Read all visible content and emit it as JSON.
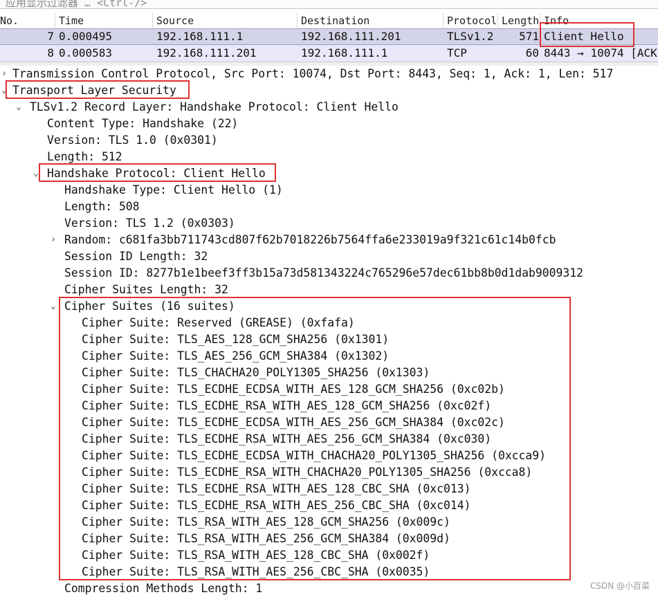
{
  "filter": {
    "placeholder": "应用显示过滤器 … <Ctrl-/>"
  },
  "columns": [
    "No.",
    "Time",
    "Source",
    "Destination",
    "Protocol",
    "Length",
    "Info"
  ],
  "packets": [
    {
      "no": "7",
      "time": "0.000495",
      "source": "192.168.111.1",
      "destination": "192.168.111.201",
      "protocol": "TLSv1.2",
      "length": "571",
      "info": "Client Hello"
    },
    {
      "no": "8",
      "time": "0.000583",
      "source": "192.168.111.201",
      "destination": "192.168.111.1",
      "protocol": "TCP",
      "length": "60",
      "info": "8443 → 10074 [ACK"
    }
  ],
  "tree": {
    "tcp": "Transmission Control Protocol, Src Port: 10074, Dst Port: 8443, Seq: 1, Ack: 1, Len: 517",
    "tls": "Transport Layer Security",
    "record": "TLSv1.2 Record Layer: Handshake Protocol: Client Hello",
    "content_type": "Content Type: Handshake (22)",
    "version": "Version: TLS 1.0 (0x0301)",
    "length": "Length: 512",
    "handshake": "Handshake Protocol: Client Hello",
    "hs_type": "Handshake Type: Client Hello (1)",
    "hs_length": "Length: 508",
    "hs_version": "Version: TLS 1.2 (0x0303)",
    "random": "Random: c681fa3bb711743cd807f62b7018226b7564ffa6e233019a9f321c61c14b0fcb",
    "session_id_length": "Session ID Length: 32",
    "session_id": "Session ID: 8277b1e1beef3ff3b15a73d581343224c765296e57dec61bb8b0d1dab9009312",
    "cipher_suites_length": "Cipher Suites Length: 32",
    "cipher_suites_header": "Cipher Suites (16 suites)",
    "cipher_suites": [
      "Cipher Suite: Reserved (GREASE) (0xfafa)",
      "Cipher Suite: TLS_AES_128_GCM_SHA256 (0x1301)",
      "Cipher Suite: TLS_AES_256_GCM_SHA384 (0x1302)",
      "Cipher Suite: TLS_CHACHA20_POLY1305_SHA256 (0x1303)",
      "Cipher Suite: TLS_ECDHE_ECDSA_WITH_AES_128_GCM_SHA256 (0xc02b)",
      "Cipher Suite: TLS_ECDHE_RSA_WITH_AES_128_GCM_SHA256 (0xc02f)",
      "Cipher Suite: TLS_ECDHE_ECDSA_WITH_AES_256_GCM_SHA384 (0xc02c)",
      "Cipher Suite: TLS_ECDHE_RSA_WITH_AES_256_GCM_SHA384 (0xc030)",
      "Cipher Suite: TLS_ECDHE_ECDSA_WITH_CHACHA20_POLY1305_SHA256 (0xcca9)",
      "Cipher Suite: TLS_ECDHE_RSA_WITH_CHACHA20_POLY1305_SHA256 (0xcca8)",
      "Cipher Suite: TLS_ECDHE_RSA_WITH_AES_128_CBC_SHA (0xc013)",
      "Cipher Suite: TLS_ECDHE_RSA_WITH_AES_256_CBC_SHA (0xc014)",
      "Cipher Suite: TLS_RSA_WITH_AES_128_GCM_SHA256 (0x009c)",
      "Cipher Suite: TLS_RSA_WITH_AES_256_GCM_SHA384 (0x009d)",
      "Cipher Suite: TLS_RSA_WITH_AES_128_CBC_SHA (0x002f)",
      "Cipher Suite: TLS_RSA_WITH_AES_256_CBC_SHA (0x0035)"
    ],
    "compression_methods_length": "Compression Methods Length: 1"
  },
  "icons": {
    "collapsed": "chevron-right-icon",
    "expanded": "chevron-down-icon"
  },
  "highlight_color": "#e03030",
  "selected_row_color": "#d4d4e8",
  "watermark": "CSDN @小百菜"
}
